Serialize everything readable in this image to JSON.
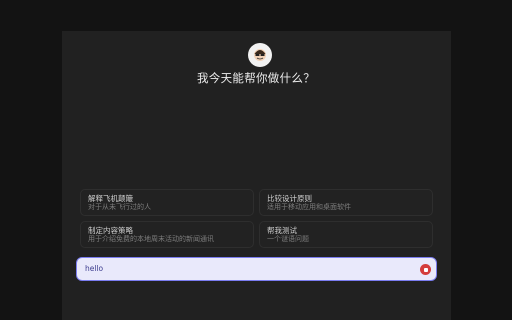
{
  "greeting": "我今天能帮你做什么？",
  "avatar_icon": "assistant-avatar-icon",
  "suggestions": [
    {
      "title": "解释飞机颠簸",
      "subtitle": "对于从未飞行过的人"
    },
    {
      "title": "比较设计原则",
      "subtitle": "适用于移动应用和桌面软件"
    },
    {
      "title": "制定内容策略",
      "subtitle": "用于介绍免费的本地周末活动的新闻通讯"
    },
    {
      "title": "帮我测试",
      "subtitle": "一个谜语问题"
    }
  ],
  "input": {
    "value": "hello"
  },
  "stop_icon": "stop-icon",
  "colors": {
    "accent": "#7a7cf0",
    "stop": "#d43c3c",
    "background": "#131313",
    "panel": "#212121"
  }
}
